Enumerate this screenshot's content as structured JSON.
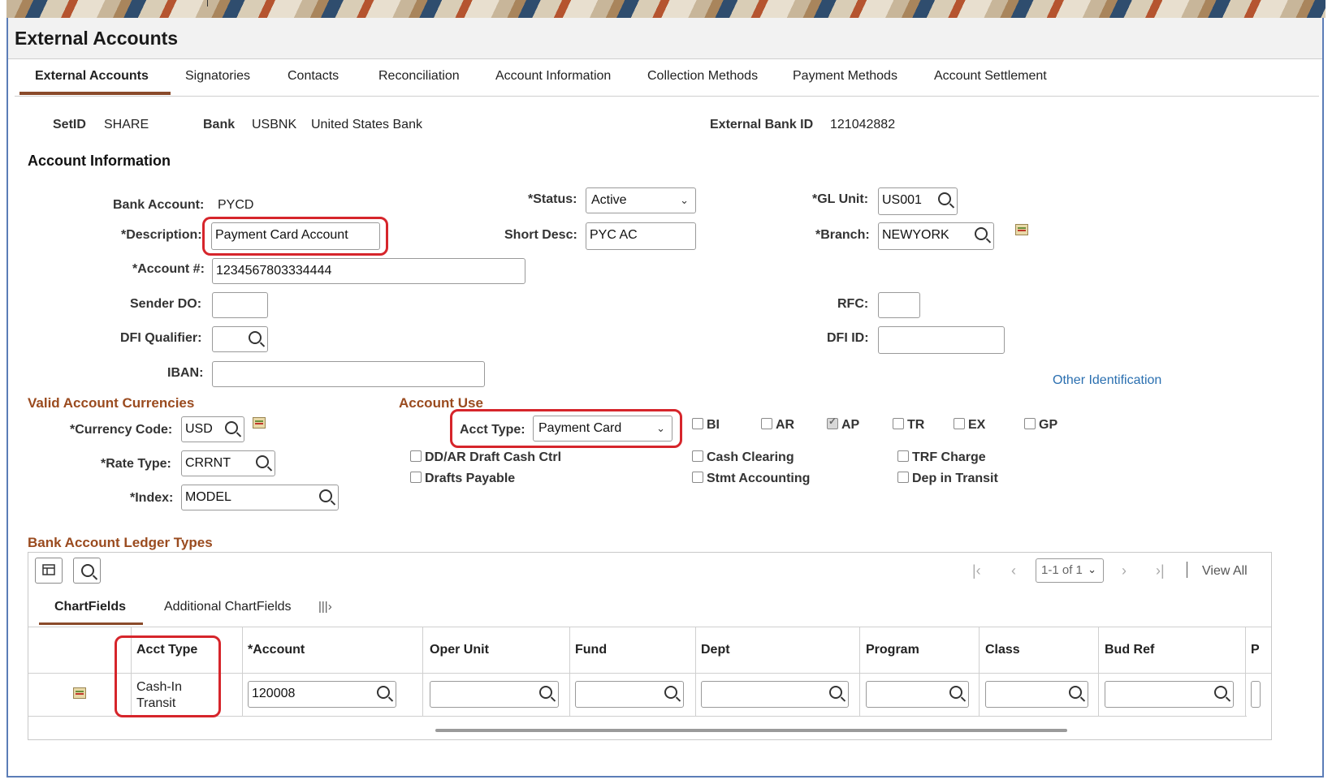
{
  "page_title": "External Accounts",
  "tabs": [
    {
      "label": "External Accounts",
      "active": true
    },
    {
      "label": "Signatories"
    },
    {
      "label": "Contacts"
    },
    {
      "label": "Reconciliation"
    },
    {
      "label": "Account Information"
    },
    {
      "label": "Collection Methods"
    },
    {
      "label": "Payment Methods"
    },
    {
      "label": "Account Settlement"
    }
  ],
  "header": {
    "setid_label": "SetID",
    "setid": "SHARE",
    "bank_label": "Bank",
    "bank_code": "USBNK",
    "bank_name": "United States Bank",
    "ext_bank_id_label": "External Bank ID",
    "ext_bank_id": "121042882"
  },
  "account_info": {
    "section_title": "Account Information",
    "bank_account_label": "Bank Account:",
    "bank_account": "PYCD",
    "description_label": "*Description:",
    "description": "Payment Card Account",
    "account_no_label": "*Account #:",
    "account_no": "1234567803334444",
    "sender_do_label": "Sender DO:",
    "dfi_qualifier_label": "DFI Qualifier:",
    "iban_label": "IBAN:",
    "status_label": "*Status:",
    "status": "Active",
    "short_desc_label": "Short Desc:",
    "short_desc": "PYC AC",
    "gl_unit_label": "*GL Unit:",
    "gl_unit": "US001",
    "branch_label": "*Branch:",
    "branch": "NEWYORK",
    "rfc_label": "RFC:",
    "dfi_id_label": "DFI ID:",
    "other_id_link": "Other Identification"
  },
  "currencies": {
    "section_title": "Valid Account Currencies",
    "currency_label": "*Currency Code:",
    "currency": "USD",
    "rate_type_label": "*Rate Type:",
    "rate_type": "CRRNT",
    "index_label": "*Index:",
    "index": "MODEL"
  },
  "account_use": {
    "section_title": "Account Use",
    "acct_type_label": "Acct Type:",
    "acct_type": "Payment Card",
    "checkboxes": {
      "bi": "BI",
      "ar": "AR",
      "ap": "AP",
      "tr": "TR",
      "ex": "EX",
      "gp": "GP",
      "ddar": "DD/AR Draft Cash Ctrl",
      "drafts": "Drafts Payable",
      "cash_clearing": "Cash Clearing",
      "stmt": "Stmt Accounting",
      "trf": "TRF Charge",
      "dep": "Dep in Transit"
    }
  },
  "ledger": {
    "section_title": "Bank Account Ledger Types",
    "pager": "1-1 of 1",
    "view_all": "View All",
    "subtabs": [
      "ChartFields",
      "Additional ChartFields"
    ],
    "columns": [
      "Acct Type",
      "*Account",
      "Oper Unit",
      "Fund",
      "Dept",
      "Program",
      "Class",
      "Bud Ref",
      "P"
    ],
    "row": {
      "acct_type_line1": "Cash-In",
      "acct_type_line2": "Transit",
      "account": "120008"
    }
  }
}
